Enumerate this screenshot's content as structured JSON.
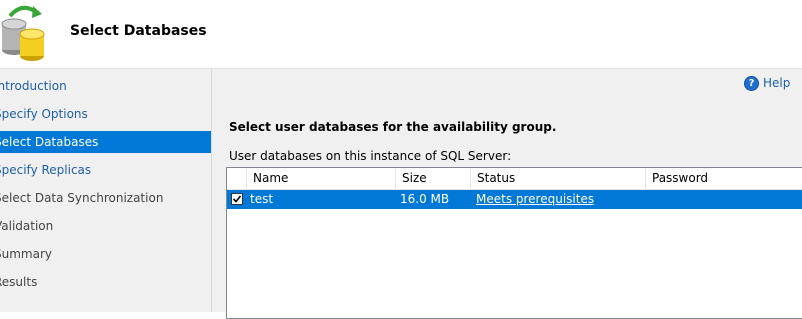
{
  "header": {
    "title": "Select Databases",
    "icon": "database-sync-icon"
  },
  "nav": {
    "items": [
      {
        "label": "Introduction",
        "state": "link"
      },
      {
        "label": "Specify Options",
        "state": "link"
      },
      {
        "label": "Select Databases",
        "state": "selected"
      },
      {
        "label": "Specify Replicas",
        "state": "link"
      },
      {
        "label": "Select Data Synchronization",
        "state": "disabled"
      },
      {
        "label": "Validation",
        "state": "disabled"
      },
      {
        "label": "Summary",
        "state": "disabled"
      },
      {
        "label": "Results",
        "state": "disabled"
      }
    ]
  },
  "main": {
    "help_label": "Help",
    "heading": "Select user databases for the availability group.",
    "sublabel": "User databases on this instance of SQL Server:",
    "grid": {
      "columns": [
        "Name",
        "Size",
        "Status",
        "Password"
      ],
      "rows": [
        {
          "checked": true,
          "name": "test",
          "size": "16.0 MB",
          "status": "Meets prerequisites",
          "password": ""
        }
      ]
    }
  },
  "colors": {
    "selection": "#0078d7",
    "link": "#1e5fa8",
    "panel": "#f0f0f0"
  }
}
